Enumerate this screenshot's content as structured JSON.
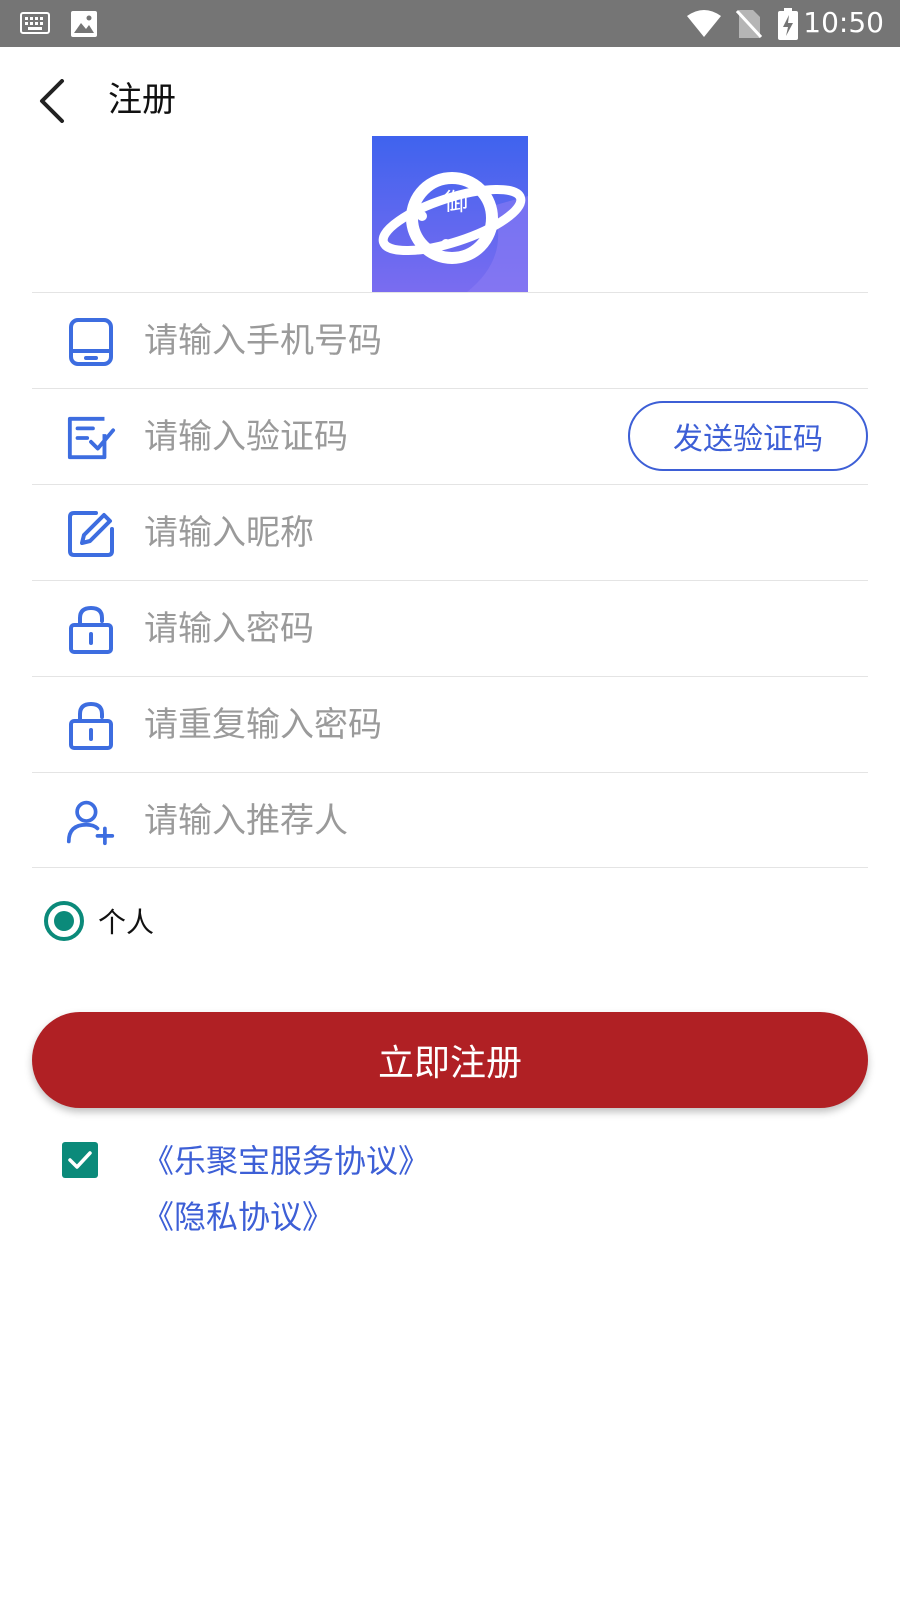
{
  "status_bar": {
    "time": "10:50",
    "left_icons": [
      "keyboard-icon",
      "image-icon"
    ],
    "right_icons": [
      "wifi-icon",
      "no-sim-icon",
      "battery-charging-icon"
    ]
  },
  "header": {
    "title": "注册",
    "back_icon": "chevron-left-icon"
  },
  "logo": {
    "text": "御",
    "colors": {
      "top": "#3f63ee",
      "bottom": "#7a6cf0"
    }
  },
  "form": {
    "phone": {
      "placeholder": "请输入手机号码",
      "value": "",
      "icon": "phone-icon"
    },
    "code": {
      "placeholder": "请输入验证码",
      "value": "",
      "icon": "verify-icon",
      "send_label": "发送验证码"
    },
    "nickname": {
      "placeholder": "请输入昵称",
      "value": "",
      "icon": "edit-icon"
    },
    "password": {
      "placeholder": "请输入密码",
      "value": "",
      "icon": "lock-icon"
    },
    "password_repeat": {
      "placeholder": "请重复输入密码",
      "value": "",
      "icon": "lock-icon"
    },
    "referrer": {
      "placeholder": "请输入推荐人",
      "value": "",
      "icon": "add-user-icon"
    }
  },
  "account_type": {
    "label": "个人",
    "selected": true
  },
  "register_button": {
    "label": "立即注册"
  },
  "agreement": {
    "checked": true,
    "service_link": "《乐聚宝服务协议》",
    "privacy_link": "《隐私协议》"
  },
  "colors": {
    "accent_blue": "#3d5fd6",
    "primary_red": "#b02024",
    "teal": "#0b8a7a",
    "status_bar": "#757575"
  }
}
